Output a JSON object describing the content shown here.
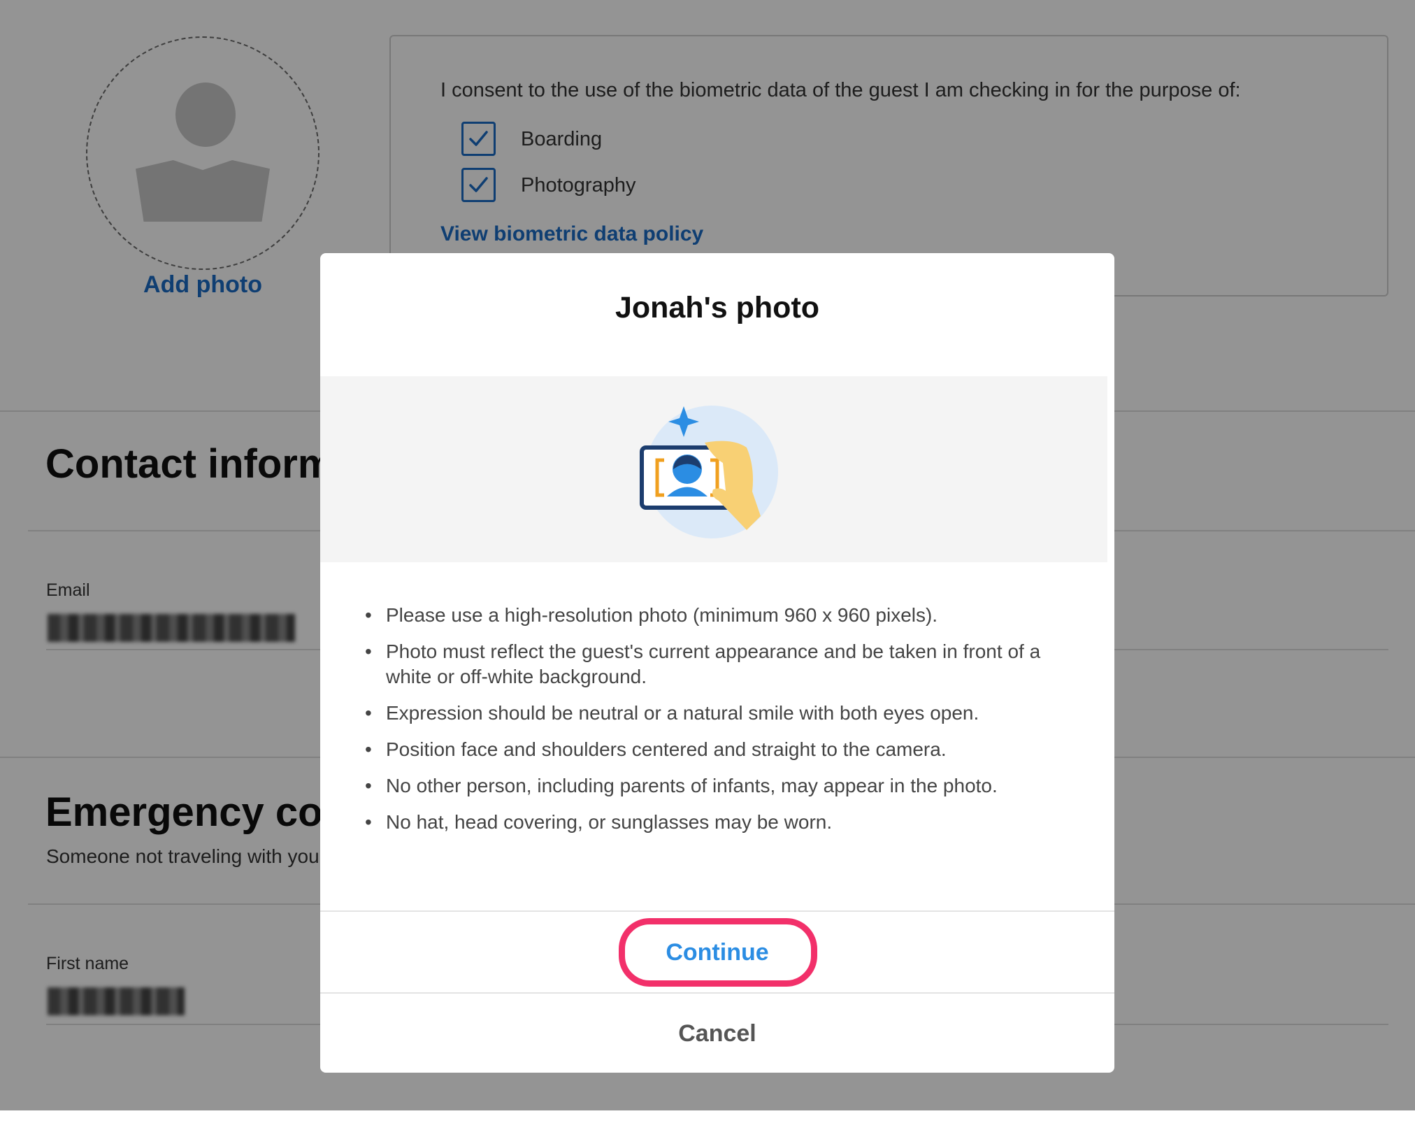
{
  "background": {
    "add_photo_label": "Add photo",
    "consent": {
      "text": "I consent to the use of the biometric data of the guest I am checking in for the purpose of:",
      "options": [
        {
          "label": "Boarding",
          "checked": true
        },
        {
          "label": "Photography",
          "checked": true
        }
      ],
      "policy_link": "View biometric data policy"
    },
    "contact_section": {
      "title": "Contact information",
      "email_label": "Email"
    },
    "emergency_section": {
      "title": "Emergency contact",
      "subtitle": "Someone not traveling with you",
      "first_name_label": "First name"
    }
  },
  "modal": {
    "title": "Jonah's photo",
    "guidelines": [
      "Please use a high-resolution photo (minimum 960 x 960 pixels).",
      "Photo must reflect the guest's current appearance and be taken in front of a white or off-white background.",
      "Expression should be neutral or a natural smile with both eyes open.",
      "Position face and shoulders centered and straight to the camera.",
      "No other person, including parents of infants, may appear in the photo.",
      "No hat, head covering, or sunglasses may be worn."
    ],
    "continue_label": "Continue",
    "cancel_label": "Cancel"
  },
  "colors": {
    "link_blue": "#1a6bc4",
    "continue_blue": "#2b8de3",
    "highlight_ring": "#f2306a",
    "overlay": "rgba(0,0,0,0.42)"
  }
}
